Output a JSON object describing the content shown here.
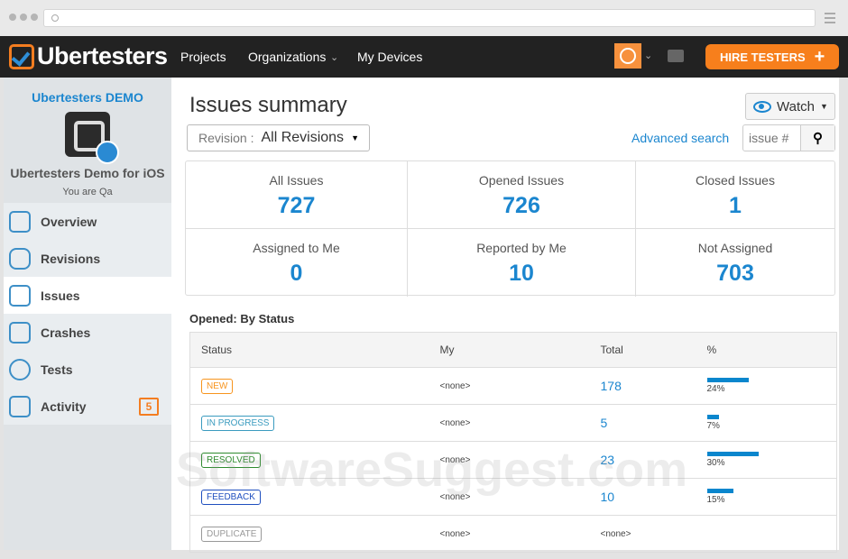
{
  "brand": "Ubertesters",
  "nav": {
    "links": [
      "Projects",
      "Organizations",
      "My Devices"
    ],
    "hire": "HIRE TESTERS"
  },
  "sidebar": {
    "org": "Ubertesters DEMO",
    "app": "Ubertesters Demo for iOS",
    "role": "You are Qa",
    "items": [
      {
        "label": "Overview"
      },
      {
        "label": "Revisions"
      },
      {
        "label": "Issues"
      },
      {
        "label": "Crashes"
      },
      {
        "label": "Tests"
      },
      {
        "label": "Activity",
        "badge": "5"
      }
    ]
  },
  "main": {
    "title": "Issues summary",
    "revision_label": "Revision :",
    "revision_value": "All Revisions",
    "watch": "Watch",
    "advanced_search": "Advanced search",
    "search_placeholder": "issue #",
    "stats": [
      {
        "label": "All Issues",
        "value": "727"
      },
      {
        "label": "Opened Issues",
        "value": "726"
      },
      {
        "label": "Closed Issues",
        "value": "1"
      },
      {
        "label": "Assigned to Me",
        "value": "0"
      },
      {
        "label": "Reported by Me",
        "value": "10"
      },
      {
        "label": "Not Assigned",
        "value": "703"
      }
    ],
    "section": "Opened: By Status",
    "columns": [
      "Status",
      "My",
      "Total",
      "%"
    ],
    "rows": [
      {
        "status": "NEW",
        "color": "#f7941d",
        "my": "<none>",
        "total": "178",
        "pct": "24%",
        "frac": 0.24
      },
      {
        "status": "IN PROGRESS",
        "color": "#3a9bbf",
        "my": "<none>",
        "total": "5",
        "pct": "7%",
        "frac": 0.07
      },
      {
        "status": "RESOLVED",
        "color": "#2e8b2e",
        "my": "<none>",
        "total": "23",
        "pct": "30%",
        "frac": 0.3
      },
      {
        "status": "FEEDBACK",
        "color": "#1f4fbf",
        "my": "<none>",
        "total": "10",
        "pct": "15%",
        "frac": 0.15
      },
      {
        "status": "DUPLICATE",
        "color": "#999999",
        "my": "<none>",
        "total": "<none>",
        "pct": "",
        "frac": 0
      }
    ]
  },
  "watermark": "SoftwareSuggest.com"
}
